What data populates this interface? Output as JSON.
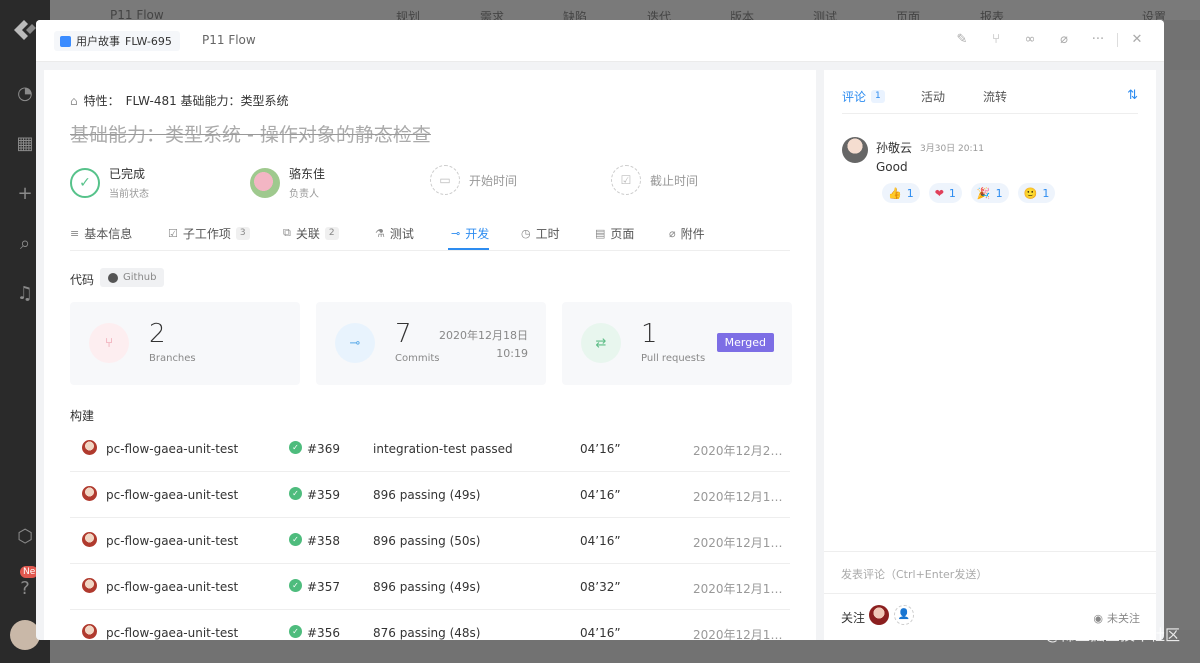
{
  "background": {
    "top_items": [
      "P11 Flow",
      "规划",
      "需求",
      "缺陷",
      "迭代",
      "版本",
      "测试",
      "页面",
      "报表",
      "设置"
    ],
    "badge": "Ne"
  },
  "header": {
    "type_tag": "用户故事",
    "item_id": "FLW-695",
    "project": "P11 Flow",
    "actions": [
      "pin-icon",
      "branch-icon",
      "link-icon",
      "attachment-icon",
      "more-icon",
      "close-icon"
    ]
  },
  "left": {
    "breadcrumb": {
      "label": "特性：",
      "ref": "FLW-481 基础能力：类型系统"
    },
    "title": "基础能力：类型系统 - 操作对象的静态检查",
    "status": {
      "value": "已完成",
      "label": "当前状态"
    },
    "assignee": {
      "name": "骆东佳",
      "label": "负责人"
    },
    "start_time": "开始时间",
    "due_time": "截止时间",
    "tabs": [
      {
        "label": "基本信息",
        "icon": "≡",
        "count": ""
      },
      {
        "label": "子工作项",
        "icon": "☑",
        "count": "3"
      },
      {
        "label": "关联",
        "icon": "⧉",
        "count": "2"
      },
      {
        "label": "测试",
        "icon": "⚗",
        "count": ""
      },
      {
        "label": "开发",
        "icon": "⊸",
        "count": ""
      },
      {
        "label": "工时",
        "icon": "◷",
        "count": ""
      },
      {
        "label": "页面",
        "icon": "▤",
        "count": ""
      },
      {
        "label": "附件",
        "icon": "⌀",
        "count": ""
      }
    ],
    "active_tab": "开发",
    "code_label": "代码",
    "github_label": "Github",
    "stats": {
      "branches": {
        "value": "2",
        "label": "Branches"
      },
      "commits": {
        "value": "7",
        "label": "Commits",
        "date": "2020年12月18日",
        "time": "10:19"
      },
      "pull_requests": {
        "value": "1",
        "label": "Pull requests",
        "badge": "Merged"
      }
    },
    "build_label": "构建",
    "builds": [
      {
        "name": "pc-flow-gaea-unit-test",
        "number": "#369",
        "message": "integration-test passed",
        "duration": "04’16”",
        "date": "2020年12月21..."
      },
      {
        "name": "pc-flow-gaea-unit-test",
        "number": "#359",
        "message": "896 passing (49s)",
        "duration": "04’16”",
        "date": "2020年12月18..."
      },
      {
        "name": "pc-flow-gaea-unit-test",
        "number": "#358",
        "message": "896 passing (50s)",
        "duration": "04’16”",
        "date": "2020年12月18..."
      },
      {
        "name": "pc-flow-gaea-unit-test",
        "number": "#357",
        "message": "896 passing (49s)",
        "duration": "08’32”",
        "date": "2020年12月17..."
      },
      {
        "name": "pc-flow-gaea-unit-test",
        "number": "#356",
        "message": "876 passing (48s)",
        "duration": "04’16”",
        "date": "2020年12月17..."
      }
    ]
  },
  "right": {
    "tabs": [
      {
        "label": "评论",
        "count": "1"
      },
      {
        "label": "活动",
        "count": ""
      },
      {
        "label": "流转",
        "count": ""
      }
    ],
    "comment": {
      "author": "孙敬云",
      "time": "3月30日 20:11",
      "text": "Good",
      "reactions": [
        {
          "emoji": "👍",
          "count": "1"
        },
        {
          "emoji": "❤",
          "count": "1"
        },
        {
          "emoji": "🎉",
          "count": "1"
        },
        {
          "emoji": "🙂",
          "count": "1"
        }
      ]
    },
    "input_placeholder": "发表评论（Ctrl+Enter发送）",
    "follow_label": "关注",
    "unfollow_label": "未关注"
  },
  "watermark": "@稀土掘金技术社区",
  "colors": {
    "accent": "#2d8cf0",
    "success": "#56c28a",
    "merged": "#7d6ee5"
  }
}
